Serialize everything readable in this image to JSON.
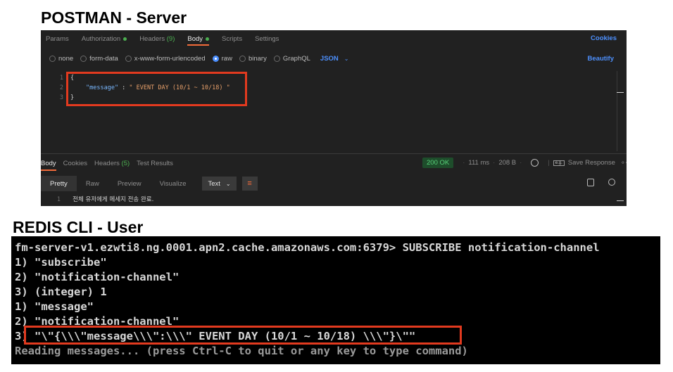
{
  "titles": {
    "postman": "POSTMAN - Server",
    "redis": "REDIS CLI - User"
  },
  "postman": {
    "tabs": [
      "Params",
      "Authorization",
      "Headers",
      "Body",
      "Scripts",
      "Settings"
    ],
    "headers_count": "(9)",
    "cookies_label": "Cookies",
    "body_types": [
      "none",
      "form-data",
      "x-www-form-urlencoded",
      "raw",
      "binary",
      "GraphQL"
    ],
    "format": "JSON",
    "beautify_label": "Beautify",
    "editor": {
      "line_numbers": [
        "1",
        "2",
        "3"
      ],
      "open_brace": "{",
      "key": "\"message\"",
      "colon": " : ",
      "value": "\" EVENT DAY (10/1 ~ 10/18) \"",
      "close_brace": "}"
    },
    "response": {
      "tabs": [
        "Body",
        "Cookies",
        "Headers",
        "Test Results"
      ],
      "headers_count": "(5)",
      "status": "200 OK",
      "time": "111 ms",
      "size": "208 B",
      "eg_label": "e.g.",
      "save_label": "Save Response",
      "more_label": "∘∘∘",
      "views": [
        "Pretty",
        "Raw",
        "Preview",
        "Visualize"
      ],
      "view_format": "Text",
      "line_number": "1",
      "line_text": "전체 유저에게 메세지 전송 완료."
    },
    "colors": {
      "accent": "#f26b3a",
      "link": "#4d90fe",
      "ok": "#59d17a",
      "highlight": "#e23a1f"
    }
  },
  "redis": {
    "lines": [
      "fm-server-v1.ezwti8.ng.0001.apn2.cache.amazonaws.com:6379> SUBSCRIBE notification-channel",
      "1) \"subscribe\"",
      "2) \"notification-channel\"",
      "3) (integer) 1",
      "1) \"message\"",
      "2) \"notification-channel\"",
      "3) \"\\\"{\\\\\\\"message\\\\\\\":\\\\\\\" EVENT DAY (10/1 ~ 10/18) \\\\\\\"}\\\"\""
    ],
    "status_line": "Reading messages... (press Ctrl-C to quit or any key to type command)"
  }
}
